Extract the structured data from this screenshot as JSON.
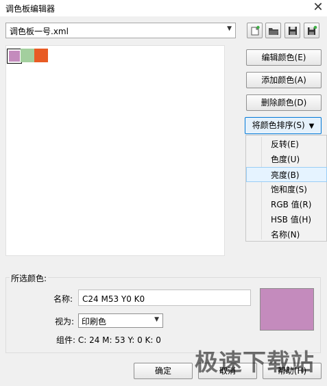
{
  "window": {
    "title": "调色板编辑器",
    "close_glyph": "✕"
  },
  "palette_select": {
    "value": "调色板一号.xml",
    "arrow": "▼"
  },
  "toolbar": {
    "new_icon": "new-palette-icon",
    "open_icon": "open-folder-icon",
    "save_icon": "save-icon",
    "save_as_icon": "save-as-icon"
  },
  "swatches": [
    {
      "color": "#c48bbd"
    },
    {
      "color": "#a3cf9e"
    },
    {
      "color": "#e85b24"
    }
  ],
  "buttons": {
    "edit_label": "编辑颜色(E)",
    "add_label": "添加颜色(A)",
    "delete_label": "删除颜色(D)",
    "sort_label": "将颜色排序(S)",
    "sort_arrow": "▼"
  },
  "sort_menu": {
    "items": [
      {
        "label": "反转(E)"
      },
      {
        "label": "色度(U)"
      },
      {
        "label": "亮度(B)"
      },
      {
        "label": "饱和度(S)"
      },
      {
        "label": "RGB 值(R)"
      },
      {
        "label": "HSB 值(H)"
      },
      {
        "label": "名称(N)"
      }
    ],
    "highlighted_index": 2
  },
  "selected_color": {
    "group_title": "所选颜色:",
    "name_label": "名称:",
    "name_value": "C24 M53 Y0 K0",
    "view_label": "视为:",
    "view_value": "印刷色",
    "view_arrow": "▼",
    "components": "组件: C: 24 M: 53 Y: 0 K: 0",
    "swatch_color": "#c48bbd"
  },
  "footer": {
    "ok_label": "确定",
    "cancel_label": "取消",
    "help_label": "帮助(H)"
  },
  "watermark": "极速下载站"
}
